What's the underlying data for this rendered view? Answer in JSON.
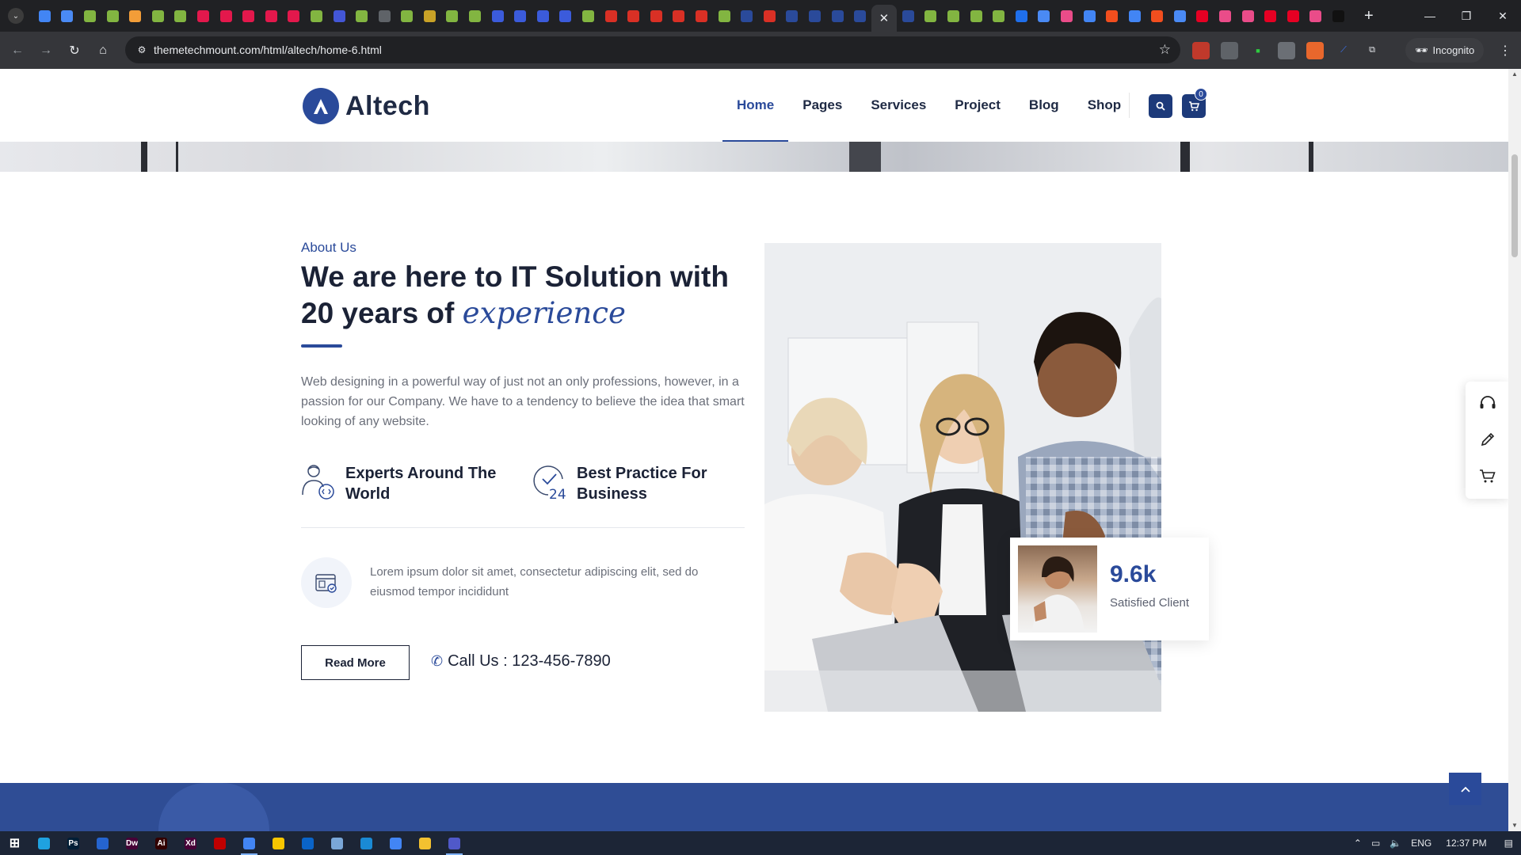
{
  "browser": {
    "tabs": [
      {
        "icon": "chrome-icon",
        "color": "#4285f4"
      },
      {
        "icon": "docs-icon",
        "color": "#4a8af4"
      },
      {
        "icon": "envato-icon",
        "color": "#82b541"
      },
      {
        "icon": "envato-icon",
        "color": "#82b541"
      },
      {
        "icon": "tool-icon",
        "color": "#f29d38"
      },
      {
        "icon": "envato-icon",
        "color": "#82b541"
      },
      {
        "icon": "envato-icon",
        "color": "#82b541"
      },
      {
        "icon": "record-icon",
        "color": "#e3184c"
      },
      {
        "icon": "record-icon",
        "color": "#e3184c"
      },
      {
        "icon": "record-icon",
        "color": "#e3184c"
      },
      {
        "icon": "record-icon",
        "color": "#e3184c"
      },
      {
        "icon": "record-icon",
        "color": "#e3184c"
      },
      {
        "icon": "envato-icon",
        "color": "#82b541"
      },
      {
        "icon": "le-icon",
        "color": "#4356d6"
      },
      {
        "icon": "envato-icon",
        "color": "#82b541"
      },
      {
        "icon": "globe-icon",
        "color": "#5f6368"
      },
      {
        "icon": "envato-icon",
        "color": "#82b541"
      },
      {
        "icon": "wrench-icon",
        "color": "#c9a227"
      },
      {
        "icon": "envato-icon",
        "color": "#82b541"
      },
      {
        "icon": "envato-icon",
        "color": "#82b541"
      },
      {
        "icon": "c-icon",
        "color": "#3b5bdb"
      },
      {
        "icon": "c-icon",
        "color": "#3b5bdb"
      },
      {
        "icon": "c-icon",
        "color": "#3b5bdb"
      },
      {
        "icon": "c-icon",
        "color": "#3b5bdb"
      },
      {
        "icon": "envato-icon",
        "color": "#82b541"
      },
      {
        "icon": "upwork-icon",
        "color": "#d93025"
      },
      {
        "icon": "upwork-icon",
        "color": "#d93025"
      },
      {
        "icon": "upwork-icon",
        "color": "#d93025"
      },
      {
        "icon": "upwork-icon",
        "color": "#d93025"
      },
      {
        "icon": "upwork-icon",
        "color": "#d93025"
      },
      {
        "icon": "envato-icon",
        "color": "#82b541"
      },
      {
        "icon": "altech-icon",
        "color": "#2a4a9a"
      },
      {
        "icon": "gmail-icon",
        "color": "#d93025"
      },
      {
        "icon": "altech-icon",
        "color": "#2a4a9a"
      },
      {
        "icon": "altech-icon",
        "color": "#2a4a9a"
      },
      {
        "icon": "altech-icon",
        "color": "#2a4a9a"
      },
      {
        "icon": "altech-icon",
        "color": "#2a4a9a"
      }
    ],
    "tabs_after": [
      {
        "icon": "altech-icon",
        "color": "#2a4a9a"
      },
      {
        "icon": "envato-icon",
        "color": "#82b541"
      },
      {
        "icon": "envato-icon",
        "color": "#82b541"
      },
      {
        "icon": "envato-icon",
        "color": "#82b541"
      },
      {
        "icon": "envato-icon",
        "color": "#82b541"
      },
      {
        "icon": "trello-icon",
        "color": "#1f6feb"
      },
      {
        "icon": "docs-icon",
        "color": "#4a8af4"
      },
      {
        "icon": "dribbble-icon",
        "color": "#ea4c89"
      },
      {
        "icon": "chrome-icon",
        "color": "#4285f4"
      },
      {
        "icon": "figma-icon",
        "color": "#f24e1e"
      },
      {
        "icon": "chrome-icon",
        "color": "#4285f4"
      },
      {
        "icon": "figma-icon",
        "color": "#f24e1e"
      },
      {
        "icon": "docs-icon",
        "color": "#4a8af4"
      },
      {
        "icon": "pinterest-icon",
        "color": "#e60023"
      },
      {
        "icon": "dribbble-icon",
        "color": "#ea4c89"
      },
      {
        "icon": "dribbble-icon",
        "color": "#ea4c89"
      },
      {
        "icon": "pinterest-icon",
        "color": "#e60023"
      },
      {
        "icon": "pinterest-icon",
        "color": "#e60023"
      },
      {
        "icon": "dribbble-icon",
        "color": "#ea4c89"
      },
      {
        "icon": "notion-icon",
        "color": "#111111"
      }
    ],
    "active_tab_close": "✕",
    "new_tab": "+",
    "url": "themetechmount.com/html/altech/home-6.html",
    "profile_label": "Incognito",
    "window_controls": [
      "—",
      "❐",
      "✕"
    ]
  },
  "site": {
    "logo_text": "Altech",
    "menu": [
      "Home",
      "Pages",
      "Services",
      "Project",
      "Blog",
      "Shop"
    ],
    "active_menu": "Home",
    "cart_count": "0",
    "about": {
      "label": "About Us",
      "title_line1": "We are here to IT Solution with",
      "title_line2_prefix": "20 years of ",
      "title_accent": "experience",
      "description": "Web designing in a powerful way of just not an only professions, however, in a passion for our Company. We have to a tendency to believe the idea that smart looking of any website.",
      "features": [
        {
          "icon": "expert-icon",
          "text": "Experts Around The World"
        },
        {
          "icon": "clock-24-icon",
          "text": "Best Practice For Business"
        }
      ],
      "lorem": "Lorem ipsum dolor sit amet, consectetur adipiscing elit, sed do eiusmod tempor incididunt",
      "read_more": "Read More",
      "call": "Call Us : 123-456-7890"
    },
    "stat": {
      "value": "9.6k",
      "label": "Satisfied Client"
    },
    "side_panel_icons": [
      "headset-icon",
      "pencil-icon",
      "cart-icon"
    ],
    "colors": {
      "brand": "#2a4a9a",
      "dark": "#1b2236",
      "band": "#2f4d95"
    }
  },
  "taskbar": {
    "apps": [
      {
        "icon": "windows-start-icon",
        "color": "#ffffff",
        "label": ""
      },
      {
        "icon": "edge-icon",
        "color": "#1fa2e0",
        "label": ""
      },
      {
        "icon": "photoshop-icon",
        "color": "#001e36",
        "label": "Ps"
      },
      {
        "icon": "todo-icon",
        "color": "#2564cf",
        "label": ""
      },
      {
        "icon": "dreamweaver-icon",
        "color": "#470137",
        "label": "Dw"
      },
      {
        "icon": "illustrator-icon",
        "color": "#330000",
        "label": "Ai"
      },
      {
        "icon": "xd-icon",
        "color": "#470137",
        "label": "Xd"
      },
      {
        "icon": "filezilla-icon",
        "color": "#bf0000",
        "label": ""
      },
      {
        "icon": "chrome-icon",
        "color": "#4285f4",
        "label": ""
      },
      {
        "icon": "sticky-notes-icon",
        "color": "#f7c600",
        "label": ""
      },
      {
        "icon": "outlook-icon",
        "color": "#0a64c8",
        "label": ""
      },
      {
        "icon": "notepad-icon",
        "color": "#7aa7d8",
        "label": ""
      },
      {
        "icon": "vscode-icon",
        "color": "#1a8ad4",
        "label": ""
      },
      {
        "icon": "chrome-icon",
        "color": "#4285f4",
        "label": ""
      },
      {
        "icon": "file-explorer-icon",
        "color": "#f3c130",
        "label": ""
      },
      {
        "icon": "teams-icon",
        "color": "#5059c9",
        "label": ""
      }
    ],
    "tray_lang": "ENG",
    "time": "12:37 PM"
  }
}
